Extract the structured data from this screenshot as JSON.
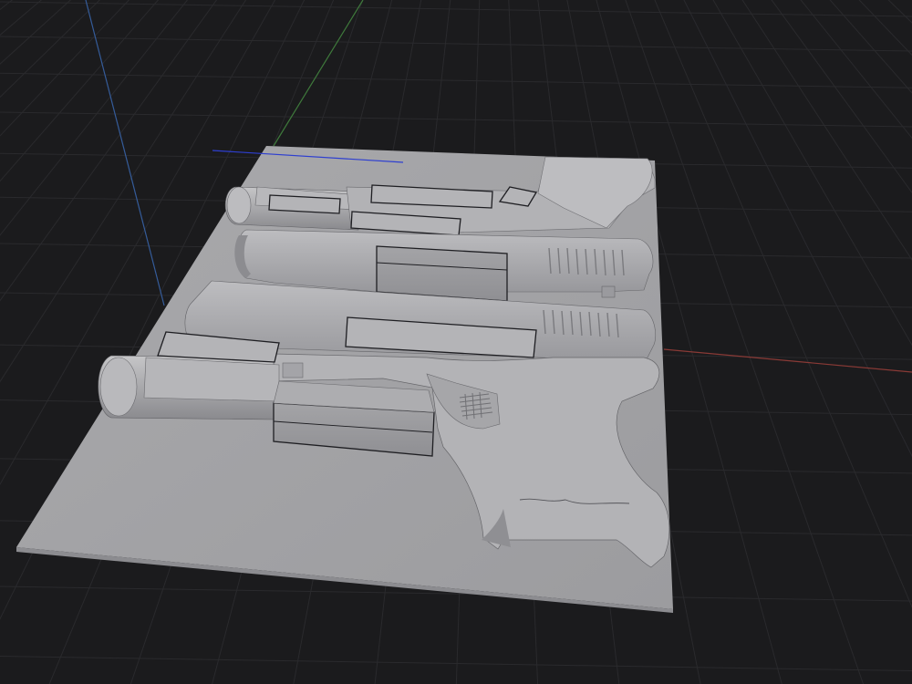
{
  "viewport": {
    "background": "#1b1b1d",
    "grid_color": "#2a2a2d",
    "x_axis_color": "#8a3a36",
    "y_axis_color": "#3f7a3c",
    "z_axis_color": "#355c9a",
    "model_base_color": "#a0a0a3",
    "model_top_color": "#b6b6b8",
    "model_highlight_color": "#c4c4c6",
    "model_shadow_color": "#7e7e82",
    "outline_color": "#1e1e22",
    "selected_edge_color": "#2e3fd0"
  },
  "scene": {
    "object": "pistol-relief-plate"
  }
}
